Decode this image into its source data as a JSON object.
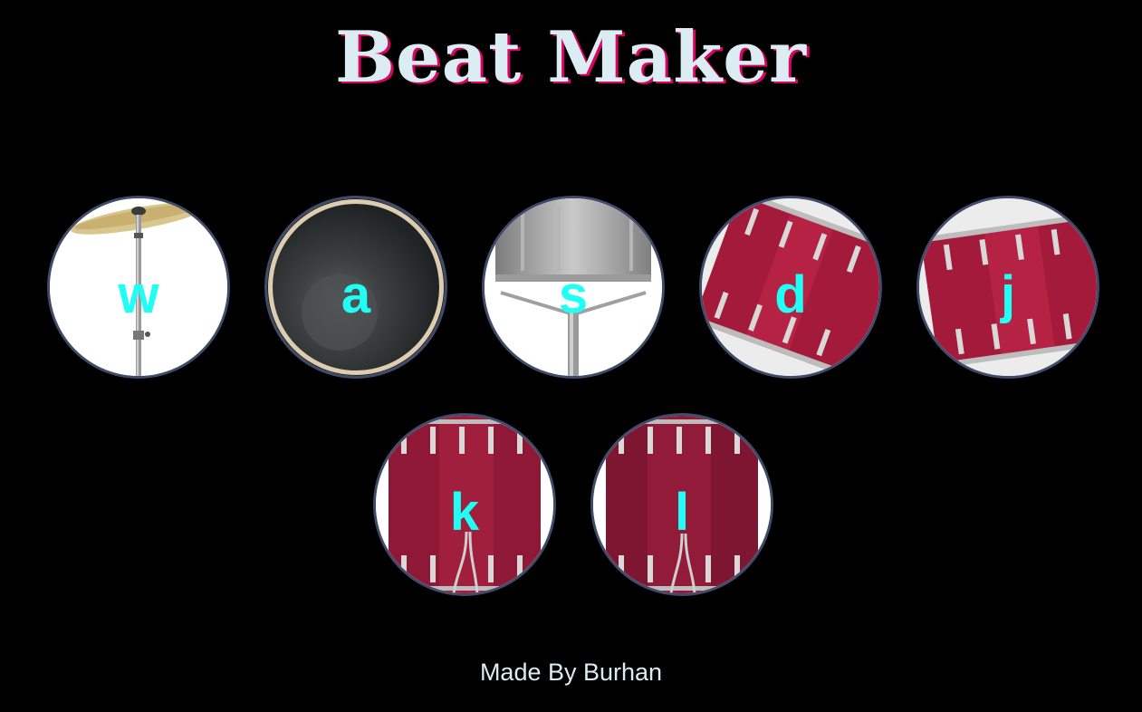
{
  "header": {
    "title": "Beat Maker"
  },
  "drums": [
    {
      "key": "w",
      "icon": "crash-cymbal-icon"
    },
    {
      "key": "a",
      "icon": "kick-drum-icon"
    },
    {
      "key": "s",
      "icon": "snare-drum-icon"
    },
    {
      "key": "d",
      "icon": "tom-1-icon"
    },
    {
      "key": "j",
      "icon": "tom-2-icon"
    },
    {
      "key": "k",
      "icon": "tom-3-icon"
    },
    {
      "key": "l",
      "icon": "tom-4-icon"
    }
  ],
  "footer": {
    "text": "Made By Burhan"
  },
  "colors": {
    "background": "#000000",
    "title": "#DBEDF3",
    "title_shadow": "#DA0463",
    "key_letter": "#1FFFF5",
    "drum_border": "#404B69",
    "drum_red": "#A31A3A"
  }
}
